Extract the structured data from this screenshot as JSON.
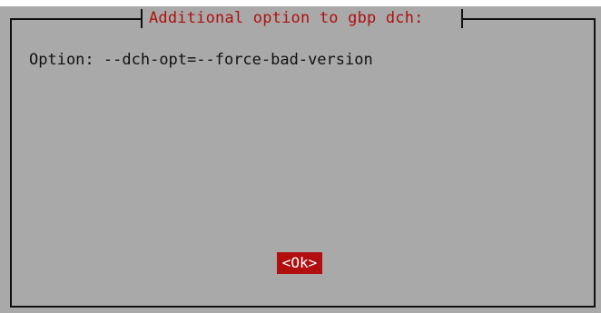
{
  "dialog": {
    "title": "Additional option to gbp dch:",
    "option_label": "Option:",
    "option_value": "--dch-opt=--force-bad-version",
    "ok_label": "<Ok>"
  },
  "colors": {
    "title_text": "#b01010",
    "dialog_background": "#a9a9a9",
    "button_background": "#b10f0f",
    "button_text": "#ffffff",
    "border": "#111111"
  }
}
